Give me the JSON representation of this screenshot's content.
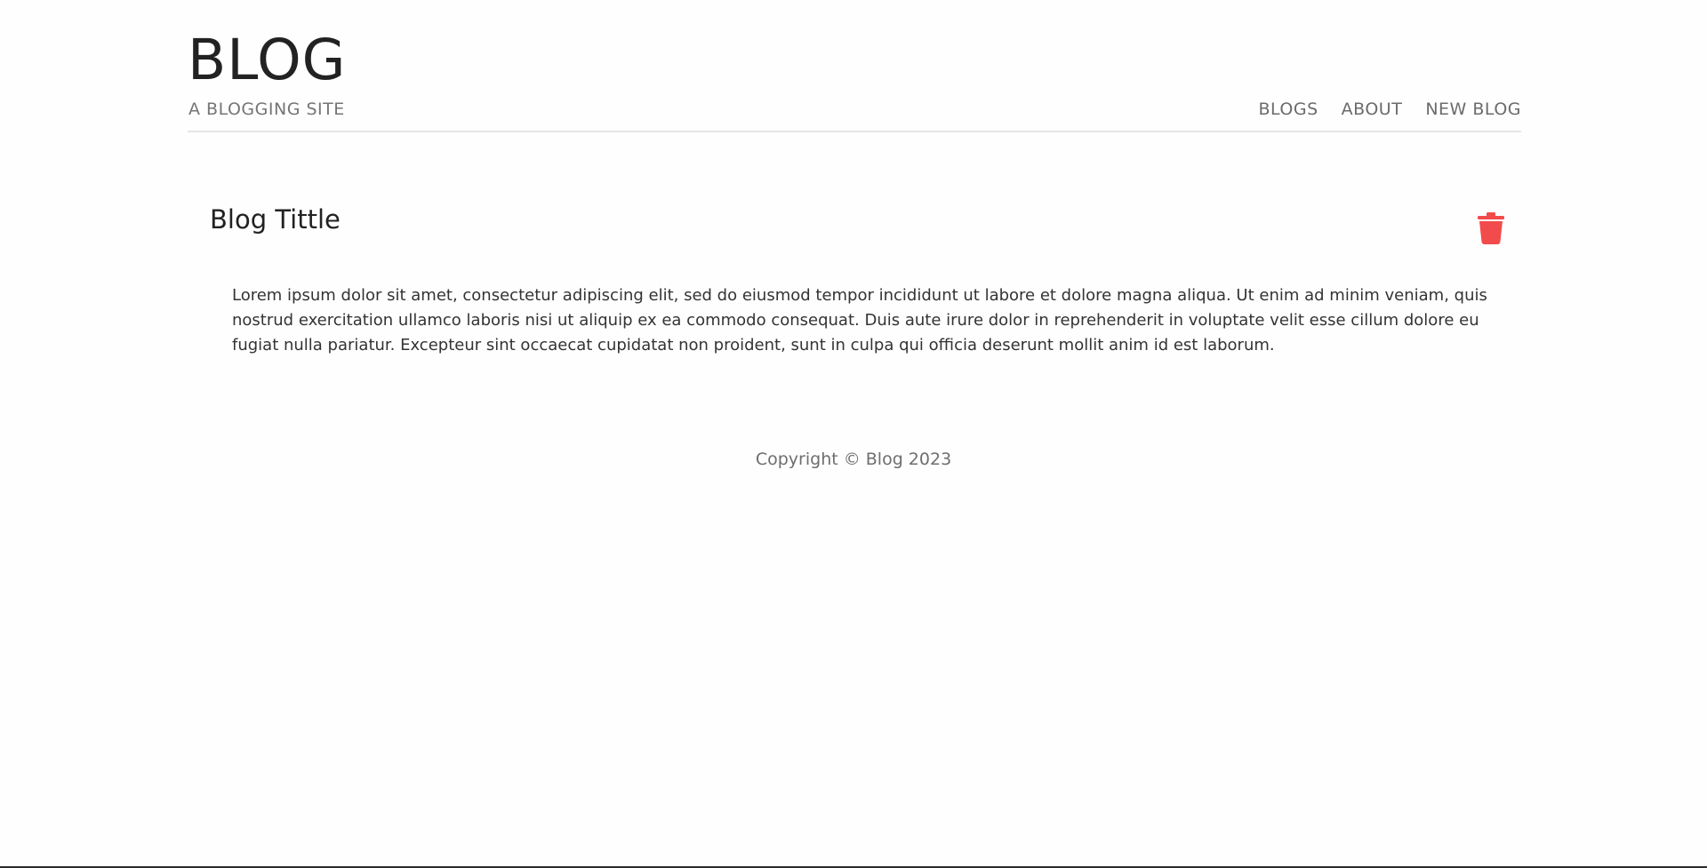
{
  "header": {
    "title": "BLOG",
    "subtitle": "A BLOGGING SITE",
    "nav": [
      {
        "label": "BLOGS"
      },
      {
        "label": "ABOUT"
      },
      {
        "label": "NEW BLOG"
      }
    ]
  },
  "post": {
    "title": "Blog Tittle",
    "body": "Lorem ipsum dolor sit amet, consectetur adipiscing elit, sed do eiusmod tempor incididunt ut labore et dolore magna aliqua. Ut enim ad minim veniam, quis nostrud exercitation ullamco laboris nisi ut aliquip ex ea commodo consequat. Duis aute irure dolor in reprehenderit in voluptate velit esse cillum dolore eu fugiat nulla pariatur. Excepteur sint occaecat cupidatat non proident, sunt in culpa qui officia deserunt mollit anim id est laborum.",
    "delete_icon": "trash-icon"
  },
  "footer": {
    "copyright": "Copyright © Blog 2023"
  },
  "colors": {
    "delete_accent": "#f24b4b",
    "title_text": "#222222",
    "muted_text": "#757575"
  }
}
